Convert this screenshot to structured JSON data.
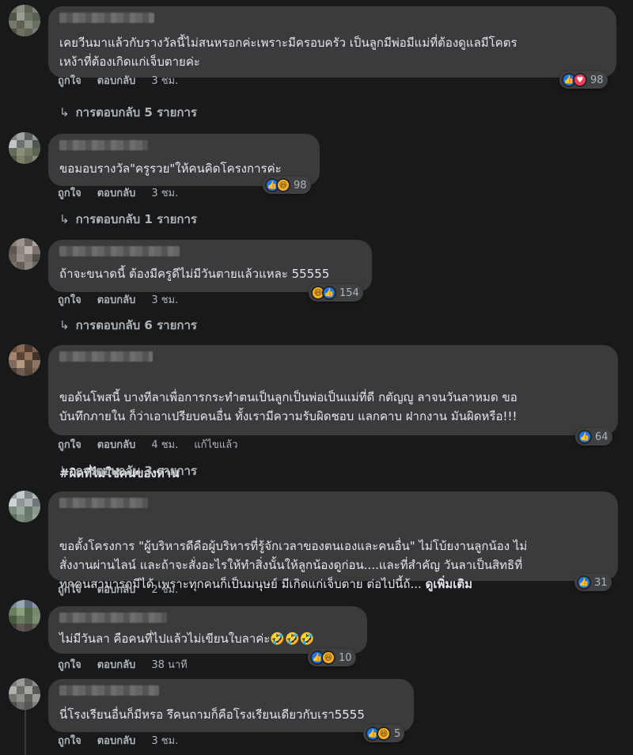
{
  "ui": {
    "like_label": "ถูกใจ",
    "reply_label": "ตอบกลับ",
    "edited_label": "แก้ไขแล้ว",
    "see_more_label": "ดูเพิ่มเติม",
    "reply_arrow": "↳"
  },
  "comments": [
    {
      "text": "เคยวีนมาแล้วกับรางวัลนี้ไม่สนหรอกค่ะเพราะมีครอบครัว เป็นลูกมีพ่อมีแม่ที่ต้องดูแลมีโคตร\nเหง้าที่ต้องเกิดแก่เจ็บตายค่ะ",
      "time": "3 ชม.",
      "reactions": [
        "like",
        "love"
      ],
      "reaction_count": "98",
      "replies": "การตอบกลับ 5 รายการ"
    },
    {
      "text": "ขอมอบรางวัล\"ครูรวย\"ให้คนคิดโครงการค่ะ",
      "time": "3 ชม.",
      "reactions": [
        "like",
        "haha"
      ],
      "reaction_count": "98",
      "replies": "การตอบกลับ 1 รายการ"
    },
    {
      "text": "ถ้าจะขนาดนี้ ต้องมีครูดีไม่มีวันตายแล้วแหละ 55555",
      "time": "3 ชม.",
      "reactions": [
        "haha",
        "like"
      ],
      "reaction_count": "154",
      "replies": "การตอบกลับ 6 รายการ"
    },
    {
      "text": "ขอด้นโพสนี้ บางทีลาเพื่อการกระทำตนเป็นลูกเป็นพ่อเป็นแม่ที่ดี กตัญญู ลาจนวันลาหมด ขอ\nบันทึกภายใน ก็ว่าเอาเปรียบคนอื่น ทั้งเรามีความรับผิดชอบ แลกคาบ ฝากงาน มันผิดหรือ!!!",
      "hashtag": "#ผิดที่ไม่ใช่คนของท่าน",
      "time": "4 ชม.",
      "edited": true,
      "reactions": [
        "like"
      ],
      "reaction_count": "64",
      "replies": "การตอบกลับ 3 รายการ"
    },
    {
      "text": "ขอตั้งโครงการ \"ผู้บริหารดีคือผู้บริหารที่รู้จักเวลาของตนเองและคนอื่น\" ไม่โบ้ยงานลูกน้อง ไม่\nสั่งงานผ่านไลน์ และถ้าจะสั่งอะไรให้ทำสิ่งนั้นให้ลูกน้องดูก่อน....และที่สำคัญ วันลาเป็นสิทธิที่\nทุกคนสามารถมีได้ เพราะทุกคนก็เป็นมนุษย์ มีเกิดแก่เจ็บตาย ต่อไปนี้ถ้... ",
      "time": "2 ชม.",
      "reactions": [
        "like"
      ],
      "reaction_count": "31"
    },
    {
      "text": "ไม่มีวันลา คือคนที่ไปแล้วไม่เขียนใบลาค่ะ🤣🤣🤣",
      "time": "38 นาที",
      "reactions": [
        "like",
        "haha"
      ],
      "reaction_count": "10"
    },
    {
      "text": "นี่โรงเรียนอื่นก็มีหรอ รึคนถามก็คือโรงเรียนเดียวกับเรา5555",
      "time": "3 ชม.",
      "reactions": [
        "like",
        "haha"
      ],
      "reaction_count": "5"
    }
  ],
  "colors": {
    "background": "#18191a",
    "bubble": "#3a3b3c",
    "text": "#e4e6eb",
    "secondary_text": "#b0b3b8",
    "like_blue": "#1877f2",
    "love_red": "#f33e58",
    "haha_yellow": "#f7b125"
  },
  "icons": {
    "like": "thumbs-up-icon",
    "love": "heart-icon",
    "haha": "laughing-face-icon",
    "reply_arrow": "reply-arrow-icon"
  }
}
